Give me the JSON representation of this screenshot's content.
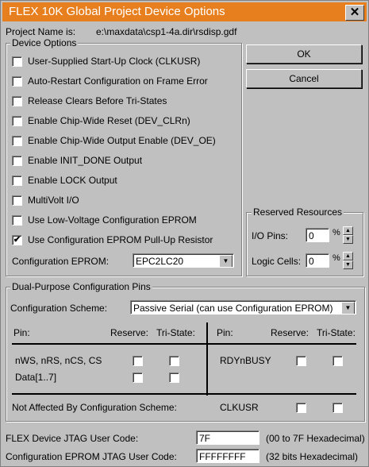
{
  "window": {
    "title": "FLEX 10K Global Project Device Options",
    "close_glyph": "✕"
  },
  "project": {
    "label": "Project Name is:",
    "path": "e:\\maxdata\\csp1-4a.dir\\rsdisp.gdf"
  },
  "buttons": {
    "ok": "OK",
    "cancel": "Cancel"
  },
  "device_options": {
    "title": "Device Options",
    "items": [
      {
        "label": "User-Supplied Start-Up Clock (CLKUSR)",
        "checked": false
      },
      {
        "label": "Auto-Restart Configuration on Frame Error",
        "checked": false
      },
      {
        "label": "Release Clears Before Tri-States",
        "checked": false
      },
      {
        "label": "Enable Chip-Wide Reset (DEV_CLRn)",
        "checked": false
      },
      {
        "label": "Enable Chip-Wide Output Enable (DEV_OE)",
        "checked": false
      },
      {
        "label": "Enable INIT_DONE Output",
        "checked": false
      },
      {
        "label": "Enable LOCK Output",
        "checked": false
      },
      {
        "label": "MultiVolt I/O",
        "checked": false
      },
      {
        "label": "Use Low-Voltage Configuration EPROM",
        "checked": false
      },
      {
        "label": "Use Configuration EPROM Pull-Up Resistor",
        "checked": true
      }
    ],
    "config_eprom_label": "Configuration EPROM:",
    "config_eprom_value": "EPC2LC20"
  },
  "reserved": {
    "title": "Reserved Resources",
    "io_pins_label": "I/O Pins:",
    "io_pins_value": "0",
    "logic_cells_label": "Logic Cells:",
    "logic_cells_value": "0",
    "percent": "%"
  },
  "dual_purpose": {
    "title": "Dual-Purpose Configuration Pins",
    "scheme_label": "Configuration Scheme:",
    "scheme_value": "Passive Serial (can use Configuration EPROM)",
    "headers": {
      "pin": "Pin:",
      "reserve": "Reserve:",
      "tristate": "Tri-State:"
    },
    "left_pins": [
      {
        "name": "nWS, nRS, nCS, CS",
        "reserve": false,
        "tristate": false
      },
      {
        "name": "Data[1..7]",
        "reserve": false,
        "tristate": false
      }
    ],
    "right_pins": [
      {
        "name": "RDYnBUSY",
        "reserve": false,
        "tristate": false
      }
    ],
    "not_affected_label": "Not Affected By Configuration Scheme:",
    "not_affected_pin": {
      "name": "CLKUSR",
      "reserve": false,
      "tristate": false
    }
  },
  "jtag": {
    "flex_label": "FLEX Device JTAG User Code:",
    "flex_value": "7F",
    "flex_hint": "(00 to 7F Hexadecimal)",
    "eprom_label": "Configuration EPROM JTAG User Code:",
    "eprom_value": "FFFFFFFF",
    "eprom_hint": "(32 bits Hexadecimal)"
  },
  "icons": {
    "check": "✔",
    "dropdown": "▼",
    "spin_up": "▲",
    "spin_down": "▼"
  }
}
